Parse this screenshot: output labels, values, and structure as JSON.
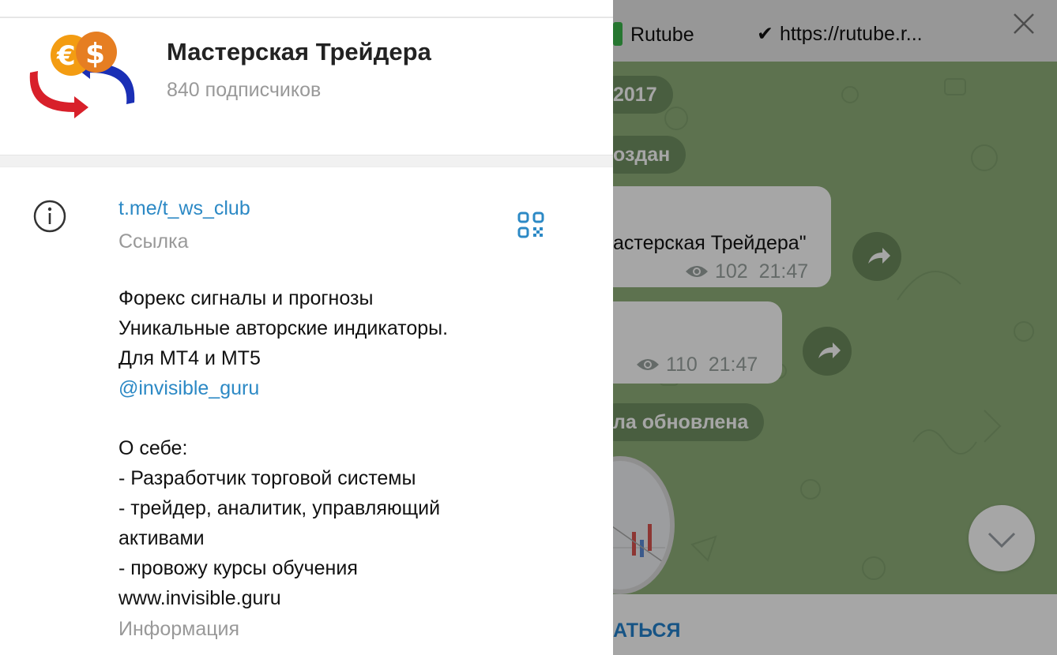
{
  "channel": {
    "name": "Мастерская Трейдера",
    "subscribers": "840 подписчиков",
    "avatar_icon": "euro-dollar-exchange-logo"
  },
  "link_section": {
    "value": "t.me/t_ws_club",
    "label": "Ссылка"
  },
  "description": {
    "lines": [
      "Форекс сигналы и прогнозы",
      "Уникальные авторские индикаторы.",
      "Для МТ4 и МТ5",
      "@invisible_guru",
      "",
      "О себе:",
      "- Разработчик торговой системы",
      "- трейдер, аналитик, управляющий",
      "активами",
      "- провожу курсы обучения",
      "www.invisible.guru"
    ],
    "label": "Информация"
  },
  "chat": {
    "pinned": [
      {
        "text": "Rutube",
        "icon": "green-bar-icon"
      },
      {
        "text": "https://rutube.r...",
        "icon": "check-icon"
      }
    ],
    "service_messages": [
      "2017",
      "оздан",
      "ла обновлена"
    ],
    "messages": [
      {
        "text": "астерская Трейдера\"",
        "views": "102",
        "time": "21:47"
      },
      {
        "text": "",
        "views": "110",
        "time": "21:47"
      }
    ],
    "footer_action": "АТЬСЯ"
  },
  "colors": {
    "link": "#2c89c5",
    "chat_background": "#8fb07a",
    "accent": "#2481cc"
  }
}
